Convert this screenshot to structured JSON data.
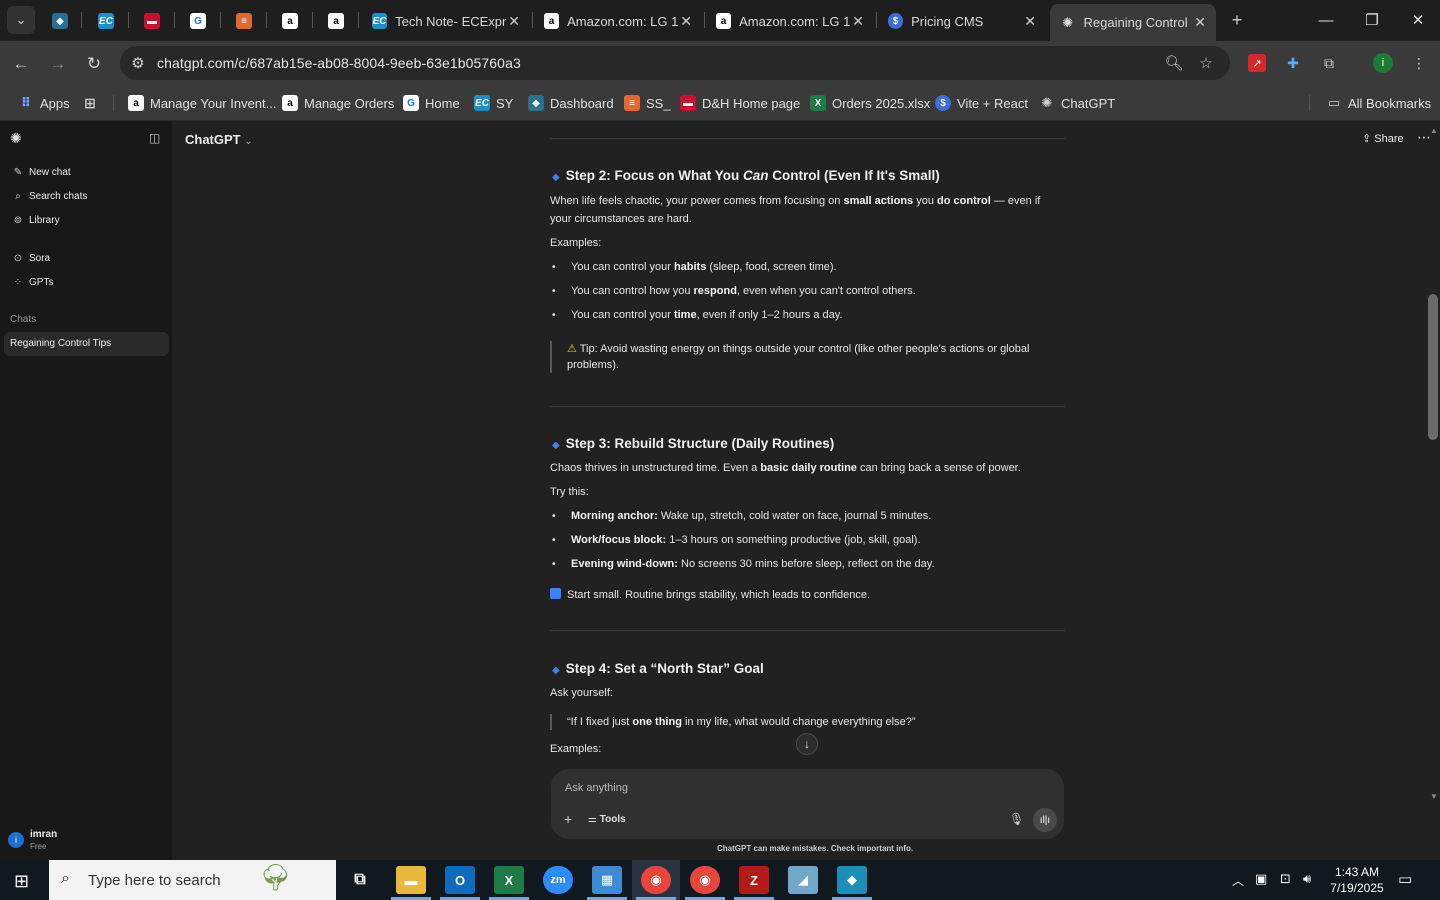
{
  "browser": {
    "tabs": [
      {
        "title": "Tech Note- ECExpr"
      },
      {
        "title": "Amazon.com: LG 1"
      },
      {
        "title": "Amazon.com: LG 1"
      },
      {
        "title": "Pricing CMS"
      },
      {
        "title": "Regaining Control"
      }
    ],
    "url": "chatgpt.com/c/687ab15e-ab08-8004-9eeb-63e1b05760a3",
    "bookmarks": [
      "Apps",
      "Manage Your Invent...",
      "Manage Orders",
      "Home",
      "SY",
      "Dashboard",
      "SS_",
      "D&H Home page",
      "Orders 2025.xlsx",
      "Vite + React",
      "ChatGPT"
    ],
    "all_bookmarks": "All Bookmarks",
    "profile_initial": "i"
  },
  "sidebar": {
    "nav": [
      {
        "label": "New chat"
      },
      {
        "label": "Search chats"
      },
      {
        "label": "Library"
      },
      {
        "label": "Sora"
      },
      {
        "label": "GPTs"
      }
    ],
    "chats_heading": "Chats",
    "active_chat": "Regaining Control Tips",
    "user": {
      "name": "imran",
      "plan": "Free",
      "initial": "i"
    }
  },
  "header": {
    "model": "ChatGPT",
    "share": "Share"
  },
  "conversation": {
    "step2": {
      "title_pre": "Step 2: Focus on What You ",
      "title_em": "Can",
      "title_post": " Control (Even If It's Small)",
      "intro_a": "When life feels chaotic, your power comes from focusing on ",
      "intro_b": "small actions",
      "intro_c": " you ",
      "intro_d": "do control",
      "intro_e": " — even if your circumstances are hard.",
      "examples_label": "Examples:",
      "items": [
        {
          "a": "You can control your ",
          "b": "habits",
          "c": " (sleep, food, screen time)."
        },
        {
          "a": "You can control how you ",
          "b": "respond",
          "c": ", even when you can't control others."
        },
        {
          "a": "You can control your ",
          "b": "time",
          "c": ", even if only 1–2 hours a day."
        }
      ],
      "tip_icon": "⚠",
      "tip": " Tip: Avoid wasting energy on things outside your control (like other people's actions or global problems)."
    },
    "step3": {
      "title": "Step 3: Rebuild Structure (Daily Routines)",
      "intro_a": "Chaos thrives in unstructured time. Even a ",
      "intro_b": "basic daily routine",
      "intro_c": " can bring back a sense of power.",
      "try_label": "Try this:",
      "items": [
        {
          "b": "Morning anchor:",
          "c": " Wake up, stretch, cold water on face, journal 5 minutes."
        },
        {
          "b": "Work/focus block:",
          "c": " 1–3 hours on something productive (job, skill, goal)."
        },
        {
          "b": "Evening wind-down:",
          "c": " No screens 30 mins before sleep, reflect on the day."
        }
      ],
      "note": "Start small. Routine brings stability, which leads to confidence."
    },
    "step4": {
      "title": "Step 4: Set a “North Star” Goal",
      "ask": "Ask yourself:",
      "quote_a": "“If I fixed just ",
      "quote_b": "one thing",
      "quote_c": " in my life, what would change everything else?”",
      "examples_label": "Examples:"
    }
  },
  "composer": {
    "placeholder": "Ask anything",
    "tools": "Tools"
  },
  "footer_note": "ChatGPT can make mistakes. Check important info.",
  "taskbar": {
    "search_placeholder": "Type here to search",
    "time": "1:43 AM",
    "date": "7/19/2025"
  },
  "colors": {
    "accent_blue": "#3b82f6",
    "bg_main": "#212121",
    "bg_sidebar": "#181818"
  }
}
